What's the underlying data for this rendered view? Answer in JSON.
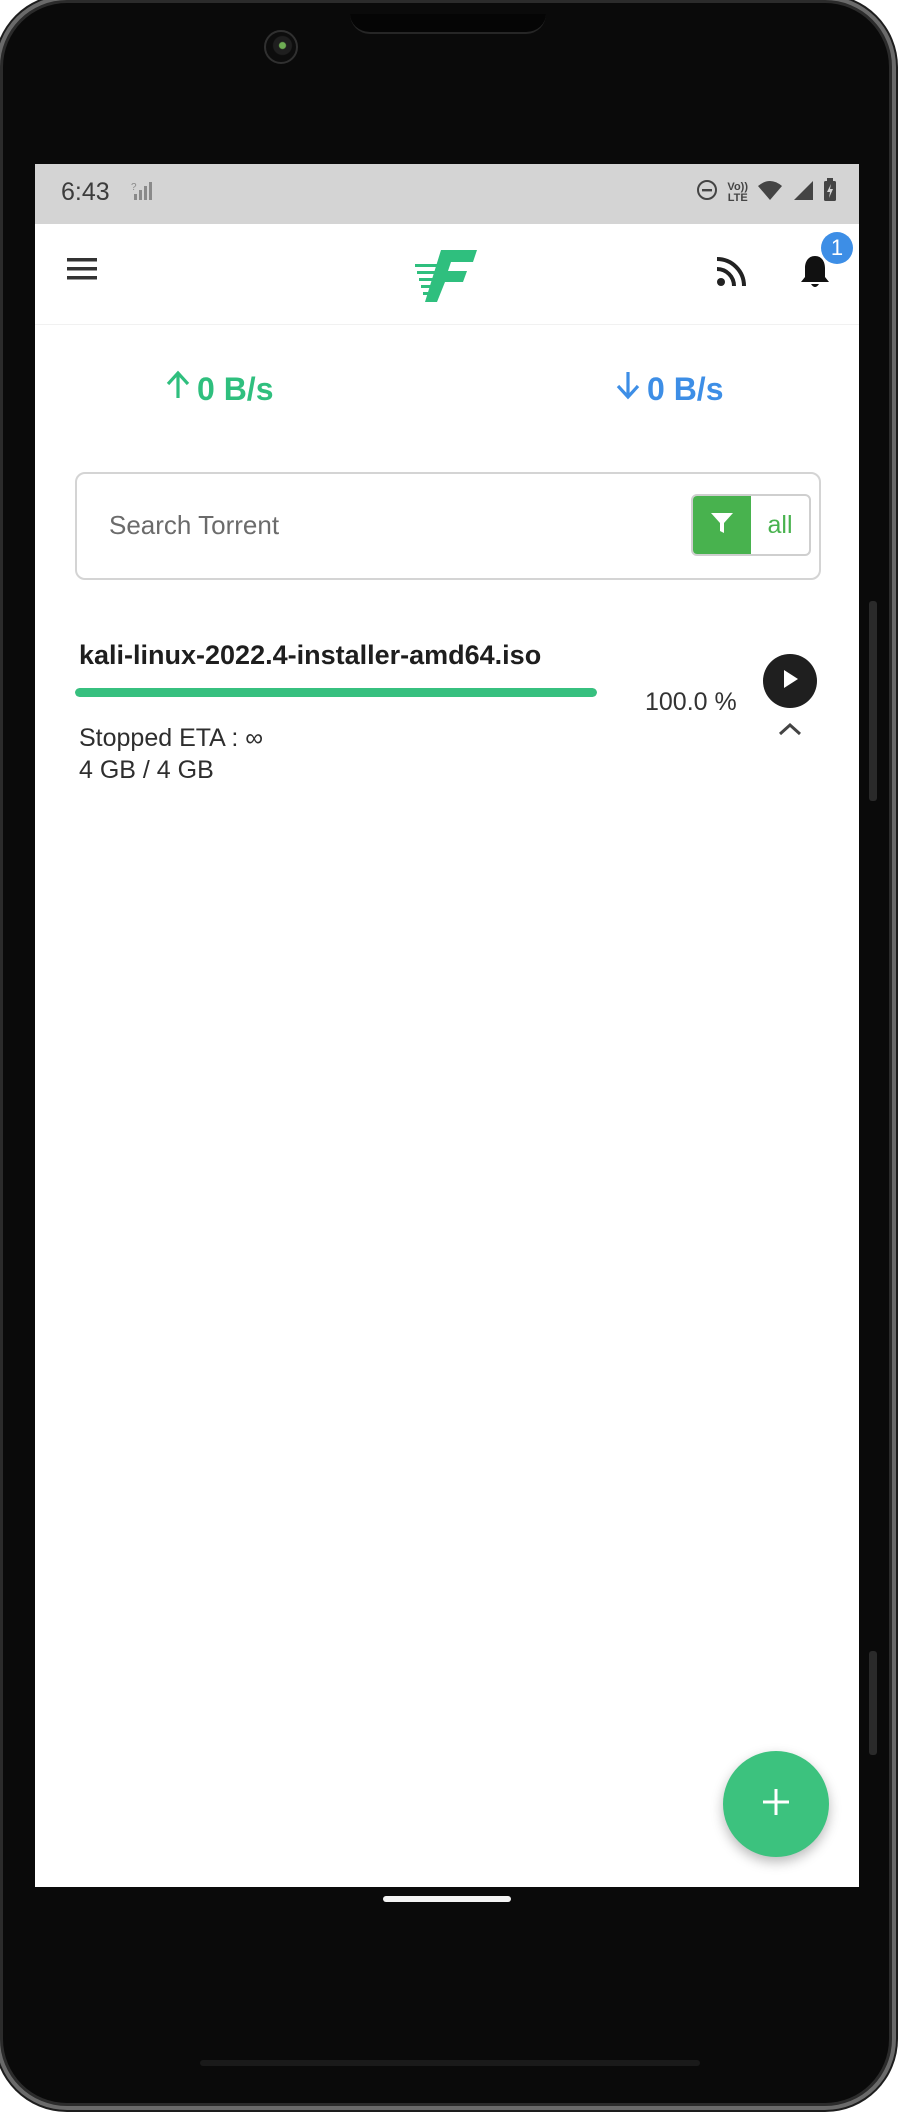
{
  "status_bar": {
    "time": "6:43",
    "volte_top": "Vo))",
    "volte_bottom": "LTE"
  },
  "app_bar": {
    "notification_count": "1"
  },
  "speeds": {
    "upload": "0 B/s",
    "download": "0 B/s"
  },
  "search": {
    "placeholder": "Search Torrent",
    "value": "",
    "filter_label": "all"
  },
  "torrents": [
    {
      "name": "kali-linux-2022.4-installer-amd64.iso",
      "progress_percent": 100.0,
      "progress_text": "100.0 %",
      "status_line": "Stopped  ETA : ∞",
      "size_line": "4 GB / 4 GB"
    }
  ],
  "colors": {
    "accent_green": "#2fbf7e",
    "accent_blue": "#3d8ee6",
    "filter_green": "#48b24e",
    "progress_green": "#37c07f"
  },
  "icons": [
    "menu-icon",
    "app-logo",
    "rss-icon",
    "bell-icon",
    "arrow-up-icon",
    "arrow-down-icon",
    "filter-icon",
    "play-icon",
    "chevron-up-icon",
    "plus-icon"
  ]
}
